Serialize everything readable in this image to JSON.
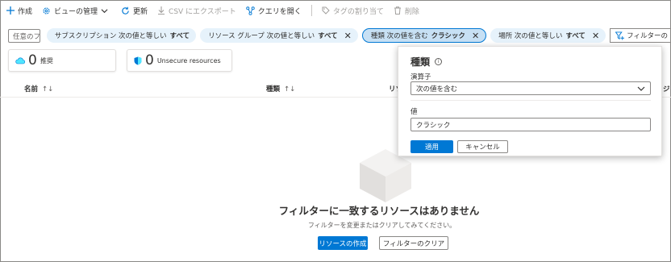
{
  "toolbar": {
    "create": "作成",
    "manage_view": "ビューの管理",
    "refresh": "更新",
    "export_csv": "CSV にエクスポート",
    "open_query": "クエリを開く",
    "assign_tags": "タグの割り当て",
    "delete": "削除"
  },
  "filters": {
    "search_placeholder": "任意のフィールドのフィルター...",
    "pills": [
      {
        "name": "サブスクリプション 次の値と等しい",
        "value": "すべて"
      },
      {
        "name": "リソース グループ 次の値と等しい",
        "value": "すべて"
      },
      {
        "name": "種類 次の値を含む",
        "value": "クラシック"
      },
      {
        "name": "場所 次の値と等しい",
        "value": "すべて"
      }
    ],
    "add_filter": "フィルターの"
  },
  "cards": {
    "recommendations": {
      "count": "0",
      "label": "推奨"
    },
    "unsecure": {
      "count": "0",
      "label": "Unsecure resources"
    }
  },
  "table": {
    "col_name": "名前",
    "col_type": "種類",
    "col_rg": "リソ",
    "col_location": "ジ",
    "sort_icon": "↑↓"
  },
  "empty": {
    "title": "フィルターに一致するリソースはありません",
    "subtitle": "フィルターを変更またはクリアしてみてください。",
    "create_button": "リソースの作成",
    "clear_button": "フィルターのクリア"
  },
  "popup": {
    "title": "種類",
    "info_icon": "i",
    "operator_label": "演算子",
    "operator_value": "次の値を含む",
    "value_label": "値",
    "value_value": "クラシック",
    "apply": "適用",
    "cancel": "キャンセル"
  },
  "colors": {
    "accent": "#0078d4",
    "pill_bg": "#e6f2fb"
  }
}
